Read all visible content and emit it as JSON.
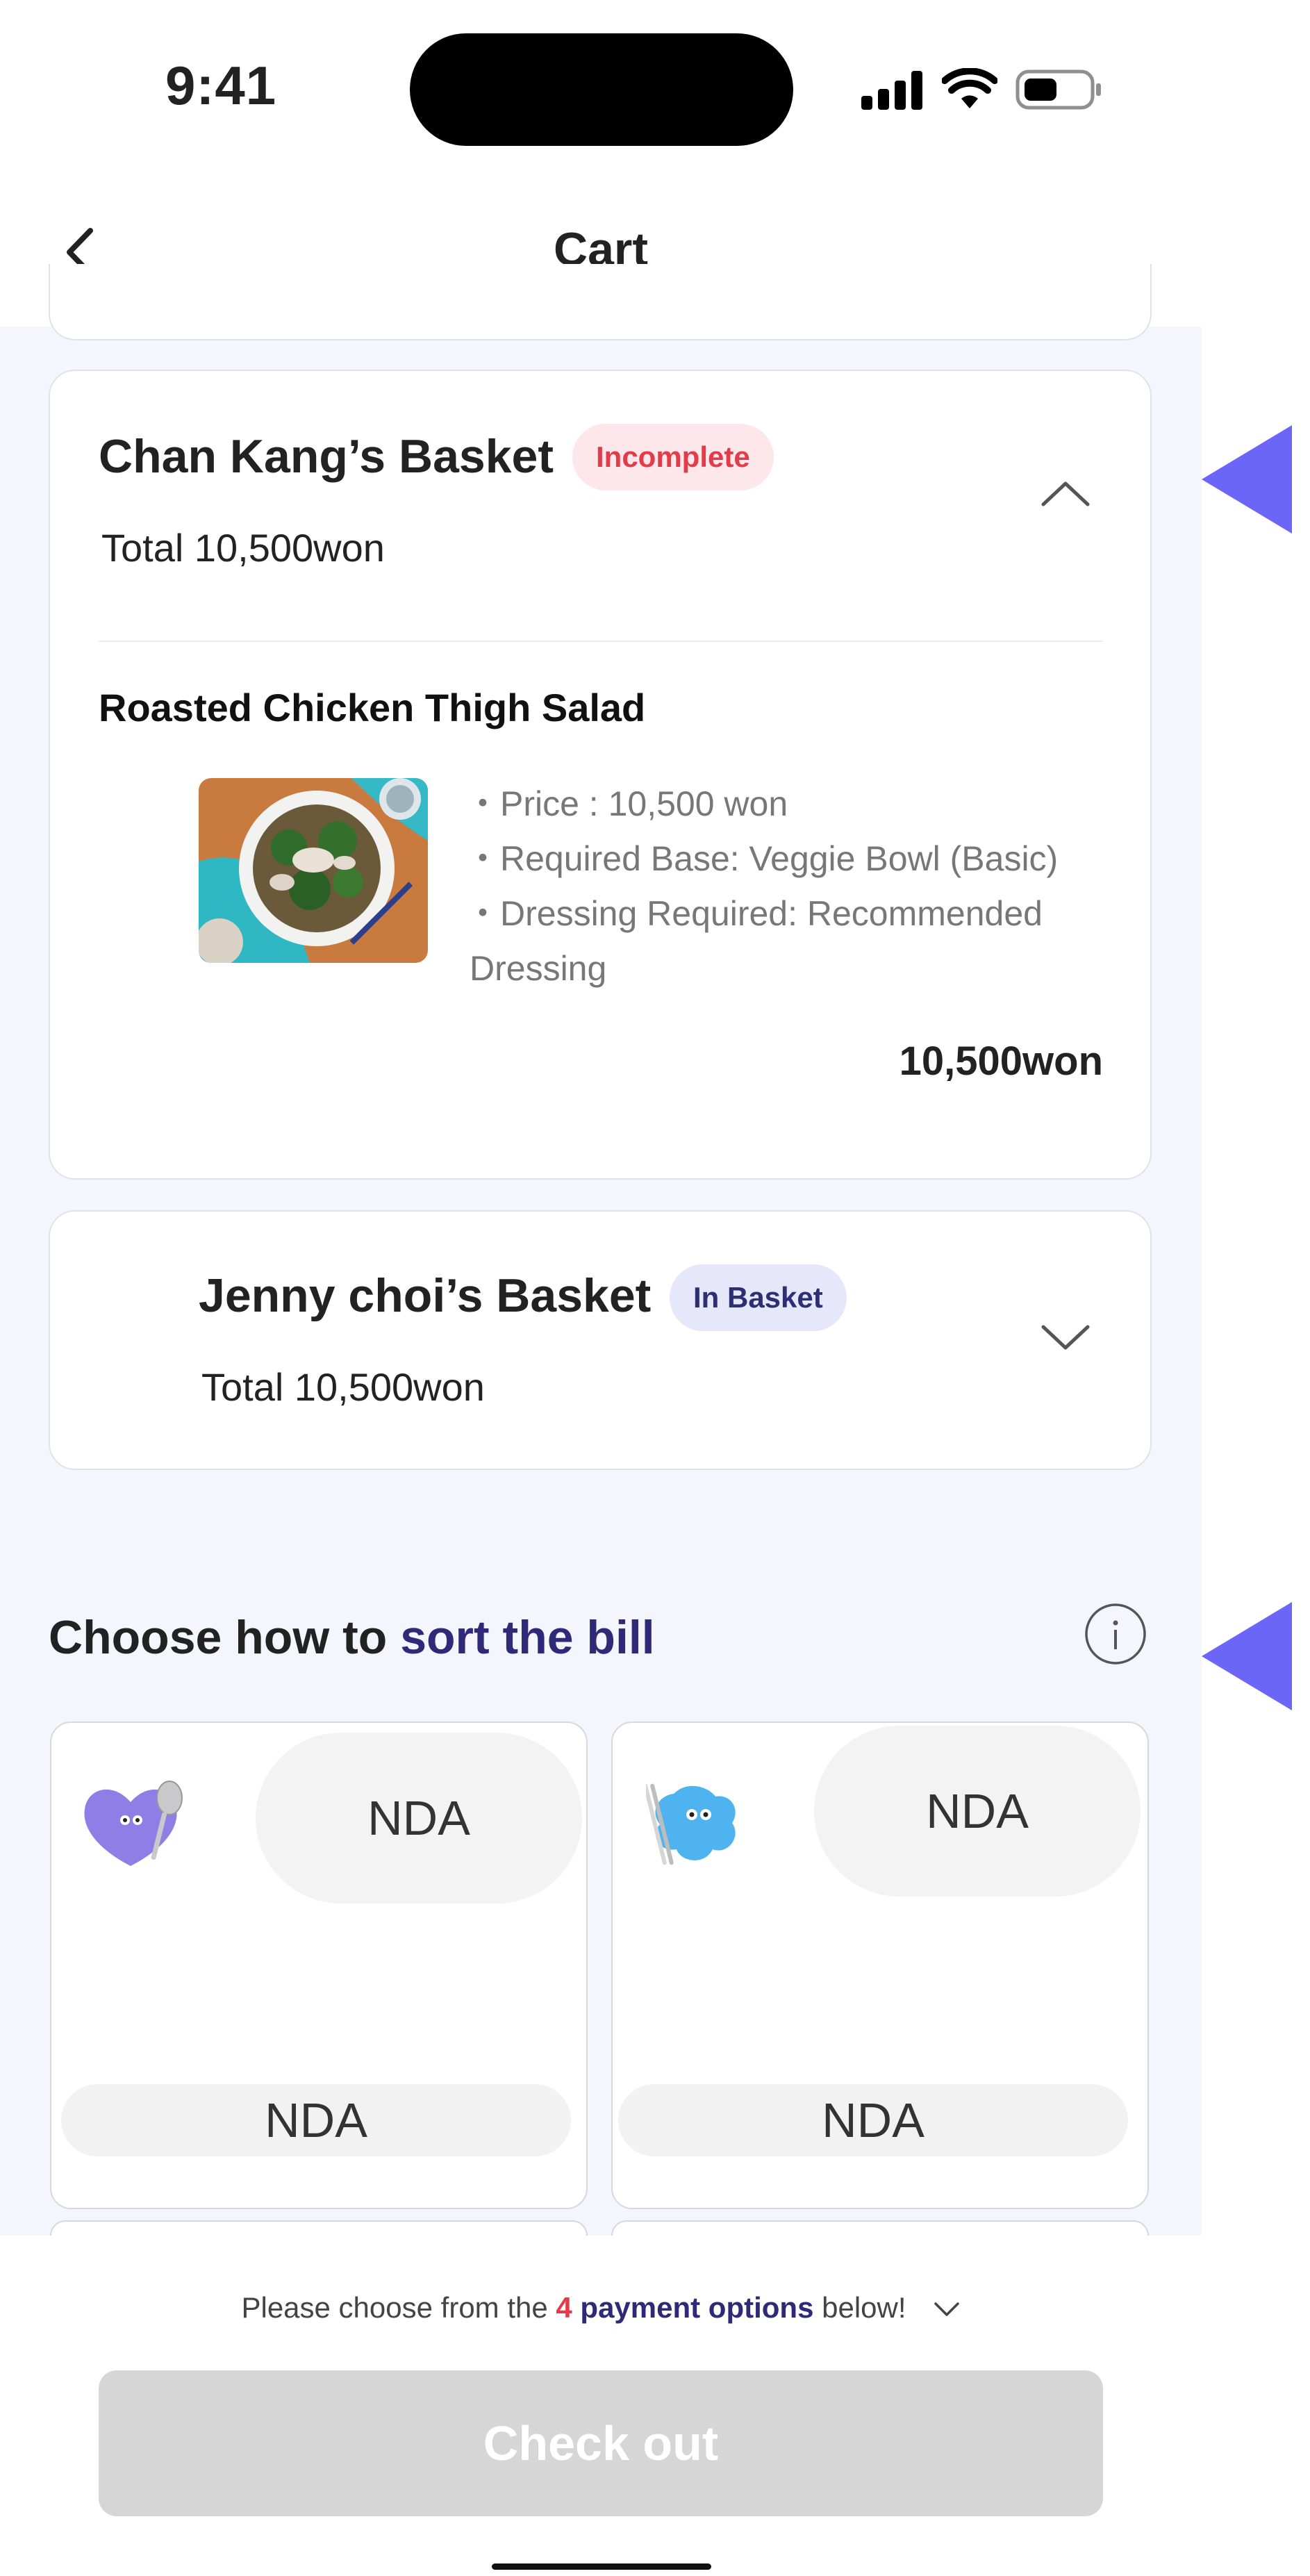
{
  "status_bar": {
    "time": "9:41"
  },
  "header": {
    "title": "Cart"
  },
  "baskets": [
    {
      "name": "Chan Kang’s Basket",
      "status": "Incomplete",
      "total": "Total 10,500won",
      "item": {
        "title": "Roasted Chicken Thigh Salad",
        "details": [
          "・Price : 10,500 won",
          "・Required Base: Veggie Bowl (Basic)",
          "・Dressing Required: Recommended",
          "Dressing"
        ],
        "price": "10,500won"
      }
    },
    {
      "name": "Jenny choi’s Basket",
      "status": "In Basket",
      "total": "Total 10,500won"
    }
  ],
  "sort_section": {
    "title_prefix": "Choose how to ",
    "title_highlight": "sort the bill",
    "options": [
      {
        "pill": "NDA",
        "bar": "NDA"
      },
      {
        "pill": "NDA",
        "bar": "NDA"
      }
    ]
  },
  "footer": {
    "hint_before": "Please choose from the ",
    "hint_count": "4",
    "hint_middle": " payment options",
    "hint_after": " below!",
    "checkout_label": "Check out"
  },
  "colors": {
    "accent": "#6b66f7",
    "navy": "#2e2a77",
    "alert_red": "#e23b4a",
    "content_bg": "#f5f6fd"
  }
}
